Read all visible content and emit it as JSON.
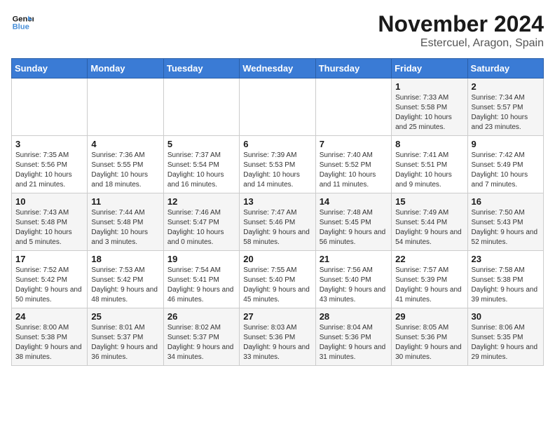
{
  "logo": {
    "line1": "General",
    "line2": "Blue"
  },
  "title": "November 2024",
  "location": "Estercuel, Aragon, Spain",
  "header": {
    "days": [
      "Sunday",
      "Monday",
      "Tuesday",
      "Wednesday",
      "Thursday",
      "Friday",
      "Saturday"
    ]
  },
  "weeks": [
    [
      {
        "day": "",
        "info": ""
      },
      {
        "day": "",
        "info": ""
      },
      {
        "day": "",
        "info": ""
      },
      {
        "day": "",
        "info": ""
      },
      {
        "day": "",
        "info": ""
      },
      {
        "day": "1",
        "info": "Sunrise: 7:33 AM\nSunset: 5:58 PM\nDaylight: 10 hours and 25 minutes."
      },
      {
        "day": "2",
        "info": "Sunrise: 7:34 AM\nSunset: 5:57 PM\nDaylight: 10 hours and 23 minutes."
      }
    ],
    [
      {
        "day": "3",
        "info": "Sunrise: 7:35 AM\nSunset: 5:56 PM\nDaylight: 10 hours and 21 minutes."
      },
      {
        "day": "4",
        "info": "Sunrise: 7:36 AM\nSunset: 5:55 PM\nDaylight: 10 hours and 18 minutes."
      },
      {
        "day": "5",
        "info": "Sunrise: 7:37 AM\nSunset: 5:54 PM\nDaylight: 10 hours and 16 minutes."
      },
      {
        "day": "6",
        "info": "Sunrise: 7:39 AM\nSunset: 5:53 PM\nDaylight: 10 hours and 14 minutes."
      },
      {
        "day": "7",
        "info": "Sunrise: 7:40 AM\nSunset: 5:52 PM\nDaylight: 10 hours and 11 minutes."
      },
      {
        "day": "8",
        "info": "Sunrise: 7:41 AM\nSunset: 5:51 PM\nDaylight: 10 hours and 9 minutes."
      },
      {
        "day": "9",
        "info": "Sunrise: 7:42 AM\nSunset: 5:49 PM\nDaylight: 10 hours and 7 minutes."
      }
    ],
    [
      {
        "day": "10",
        "info": "Sunrise: 7:43 AM\nSunset: 5:48 PM\nDaylight: 10 hours and 5 minutes."
      },
      {
        "day": "11",
        "info": "Sunrise: 7:44 AM\nSunset: 5:48 PM\nDaylight: 10 hours and 3 minutes."
      },
      {
        "day": "12",
        "info": "Sunrise: 7:46 AM\nSunset: 5:47 PM\nDaylight: 10 hours and 0 minutes."
      },
      {
        "day": "13",
        "info": "Sunrise: 7:47 AM\nSunset: 5:46 PM\nDaylight: 9 hours and 58 minutes."
      },
      {
        "day": "14",
        "info": "Sunrise: 7:48 AM\nSunset: 5:45 PM\nDaylight: 9 hours and 56 minutes."
      },
      {
        "day": "15",
        "info": "Sunrise: 7:49 AM\nSunset: 5:44 PM\nDaylight: 9 hours and 54 minutes."
      },
      {
        "day": "16",
        "info": "Sunrise: 7:50 AM\nSunset: 5:43 PM\nDaylight: 9 hours and 52 minutes."
      }
    ],
    [
      {
        "day": "17",
        "info": "Sunrise: 7:52 AM\nSunset: 5:42 PM\nDaylight: 9 hours and 50 minutes."
      },
      {
        "day": "18",
        "info": "Sunrise: 7:53 AM\nSunset: 5:42 PM\nDaylight: 9 hours and 48 minutes."
      },
      {
        "day": "19",
        "info": "Sunrise: 7:54 AM\nSunset: 5:41 PM\nDaylight: 9 hours and 46 minutes."
      },
      {
        "day": "20",
        "info": "Sunrise: 7:55 AM\nSunset: 5:40 PM\nDaylight: 9 hours and 45 minutes."
      },
      {
        "day": "21",
        "info": "Sunrise: 7:56 AM\nSunset: 5:40 PM\nDaylight: 9 hours and 43 minutes."
      },
      {
        "day": "22",
        "info": "Sunrise: 7:57 AM\nSunset: 5:39 PM\nDaylight: 9 hours and 41 minutes."
      },
      {
        "day": "23",
        "info": "Sunrise: 7:58 AM\nSunset: 5:38 PM\nDaylight: 9 hours and 39 minutes."
      }
    ],
    [
      {
        "day": "24",
        "info": "Sunrise: 8:00 AM\nSunset: 5:38 PM\nDaylight: 9 hours and 38 minutes."
      },
      {
        "day": "25",
        "info": "Sunrise: 8:01 AM\nSunset: 5:37 PM\nDaylight: 9 hours and 36 minutes."
      },
      {
        "day": "26",
        "info": "Sunrise: 8:02 AM\nSunset: 5:37 PM\nDaylight: 9 hours and 34 minutes."
      },
      {
        "day": "27",
        "info": "Sunrise: 8:03 AM\nSunset: 5:36 PM\nDaylight: 9 hours and 33 minutes."
      },
      {
        "day": "28",
        "info": "Sunrise: 8:04 AM\nSunset: 5:36 PM\nDaylight: 9 hours and 31 minutes."
      },
      {
        "day": "29",
        "info": "Sunrise: 8:05 AM\nSunset: 5:36 PM\nDaylight: 9 hours and 30 minutes."
      },
      {
        "day": "30",
        "info": "Sunrise: 8:06 AM\nSunset: 5:35 PM\nDaylight: 9 hours and 29 minutes."
      }
    ]
  ]
}
